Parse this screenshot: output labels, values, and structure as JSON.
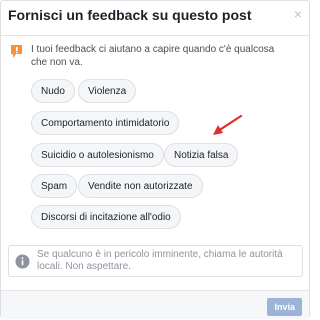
{
  "dialog": {
    "title": "Fornisci un feedback su questo post",
    "close_symbol": "×"
  },
  "intro": {
    "icon": "flag-icon",
    "text": "I tuoi feedback ci aiutano a capire quando c'è qualcosa che non va."
  },
  "options": [
    "Nudo",
    "Violenza",
    "Comportamento intimidatorio",
    "Suicidio o autolesionismo",
    "Notizia falsa",
    "Spam",
    "Vendite non autorizzate",
    "Discorsi di incitazione all'odio"
  ],
  "info": {
    "icon": "info-icon",
    "text": "Se qualcuno è in pericolo imminente, chiama le autorità locali. Non aspettare."
  },
  "footer": {
    "send_label": "Invia"
  },
  "colors": {
    "accent_disabled": "#9cb4d8",
    "flag": "#f7923b",
    "annotation_arrow": "#e0302a"
  }
}
